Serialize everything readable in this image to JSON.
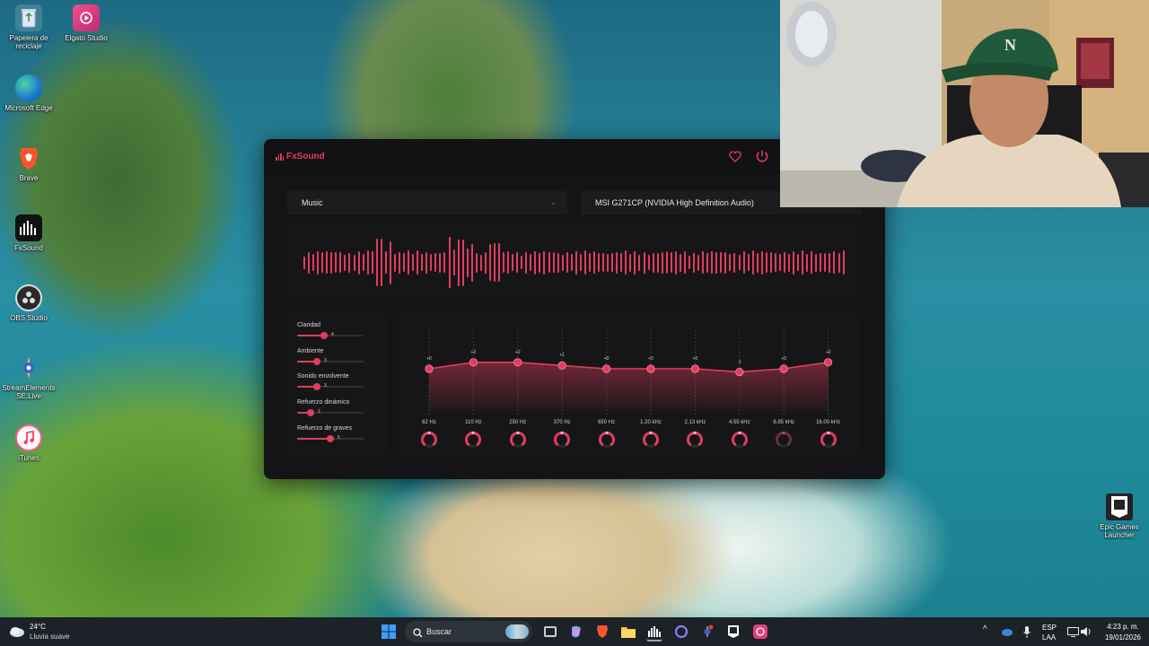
{
  "desktop": {
    "icons": [
      {
        "label": "Papelera de reciclaje"
      },
      {
        "label": "Elgato Studio"
      },
      {
        "label": "Microsoft Edge"
      },
      {
        "label": "Brave"
      },
      {
        "label": "FxSound"
      },
      {
        "label": "OBS Studio"
      },
      {
        "label": "StreamElements SE.Live"
      },
      {
        "label": "iTunes"
      },
      {
        "label": "Epic Games Launcher"
      }
    ]
  },
  "fxsound": {
    "logo": "FxSound",
    "preset": "Music",
    "device": "MSI G271CP (NVIDIA High Definition Audio)",
    "effects": [
      {
        "name": "Claridad",
        "value": "4",
        "level": 0.4
      },
      {
        "name": "Ambiente",
        "value": "3",
        "level": 0.3
      },
      {
        "name": "Sonido envolvente",
        "value": "3",
        "level": 0.3
      },
      {
        "name": "Refuerzo dinámico",
        "value": "2",
        "level": 0.2
      },
      {
        "name": "Refuerzo de graves",
        "value": "5",
        "level": 0.5
      }
    ],
    "eq": {
      "bands": [
        {
          "freq": "62 Hz",
          "gain": "+0",
          "gain_db": 0
        },
        {
          "freq": "110 Hz",
          "gain": "+2",
          "gain_db": 2
        },
        {
          "freq": "250 Hz",
          "gain": "+2",
          "gain_db": 2
        },
        {
          "freq": "370 Hz",
          "gain": "+1",
          "gain_db": 1
        },
        {
          "freq": "650 Hz",
          "gain": "+0",
          "gain_db": 0
        },
        {
          "freq": "1.20 kHz",
          "gain": "+0",
          "gain_db": 0
        },
        {
          "freq": "2.13 kHz",
          "gain": "+0",
          "gain_db": 0
        },
        {
          "freq": "4.55 kHz",
          "gain": "-1",
          "gain_db": -1
        },
        {
          "freq": "6.85 kHz",
          "gain": "+0",
          "gain_db": 0
        },
        {
          "freq": "16.00 kHz",
          "gain": "+2",
          "gain_db": 2
        }
      ]
    },
    "accent_color": "#e23c5e"
  },
  "taskbar": {
    "weather_temp": "24°C",
    "weather_desc": "Lluvia suave",
    "search_placeholder": "Buscar",
    "language_top": "ESP",
    "language_bottom": "LAA",
    "time": "4:23 p. m.",
    "date": "19/01/2026"
  }
}
